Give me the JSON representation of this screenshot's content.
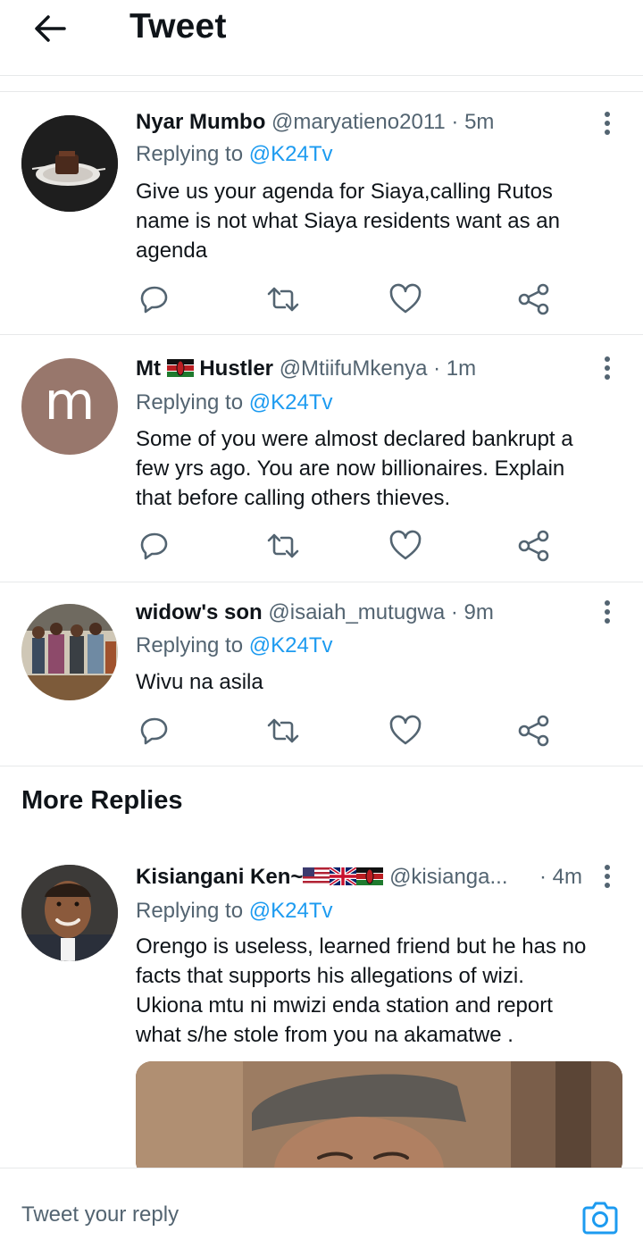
{
  "header": {
    "title": "Tweet"
  },
  "tweets": [
    {
      "name": "Nyar Mumbo",
      "handle": "@maryatieno2011",
      "time": "5m",
      "replying_to_prefix": "Replying to ",
      "replying_to_handle": "@K24Tv",
      "lines": [
        "Give us your agenda for Siaya,calling Rutos",
        "name is not what Siaya residents want as an",
        "agenda"
      ]
    },
    {
      "name_part1": "Mt",
      "name_part2": "Hustler",
      "handle": "@MtiifuMkenya",
      "time": "1m",
      "avatar_letter": "m",
      "replying_to_prefix": "Replying to ",
      "replying_to_handle": "@K24Tv",
      "lines": [
        "Some of you were almost declared bankrupt a",
        "few yrs ago. You are now billionaires. Explain",
        "that before calling others thieves."
      ]
    },
    {
      "name": "widow's son",
      "handle": "@isaiah_mutugwa",
      "time": "9m",
      "replying_to_prefix": "Replying to ",
      "replying_to_handle": "@K24Tv",
      "lines": [
        "Wivu na asila"
      ]
    }
  ],
  "more_replies": {
    "title": "More Replies",
    "tweet": {
      "name": "Kisiangani Ken~",
      "handle": "@kisianga...",
      "time": "4m",
      "replying_to_prefix": "Replying to ",
      "replying_to_handle": "@K24Tv",
      "lines": [
        "Orengo is useless, learned friend but he has no",
        "facts that supports his allegations of wizi.",
        "Ukiona mtu ni mwizi enda station and report",
        "what s/he stole from you na akamatwe ."
      ]
    }
  },
  "composer": {
    "placeholder": "Tweet your reply"
  },
  "dot": "·",
  "colors": {
    "accent": "#1d9bf0",
    "secondary_text": "#536471",
    "avatar_m_bg": "#98776c"
  },
  "icons": [
    "back-arrow-icon",
    "more-icon",
    "reply-icon",
    "retweet-icon",
    "like-icon",
    "share-icon",
    "camera-icon"
  ]
}
